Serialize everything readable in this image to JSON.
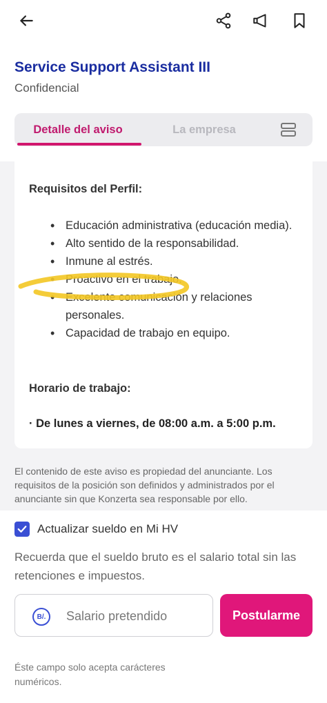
{
  "header": {
    "job_title": "Service Support Assistant III",
    "company": "Confidencial"
  },
  "tabs": [
    {
      "label": "Detalle del aviso",
      "active": true
    },
    {
      "label": "La empresa",
      "active": false
    }
  ],
  "icons": [
    "back-arrow-icon",
    "share-icon",
    "megaphone-icon",
    "bookmark-icon",
    "menu-icon"
  ],
  "description": {
    "requirements_heading": "Requisitos del Perfil:",
    "requirements": [
      "Educación administrativa (educación media).",
      "Alto sentido de la responsabilidad.",
      "Inmune al estrés.",
      "Proactivo en el trabajo.",
      "Excelente comunicación y relaciones personales.",
      "Capacidad de trabajo en equipo."
    ],
    "schedule_heading": "Horario de trabajo:",
    "schedule": "· De lunes a viernes, de 08:00 a.m. a 5:00 p.m."
  },
  "disclaimer": "El contenido de este aviso es propiedad del anunciante. Los requisitos de la posición son definidos y administrados por el anunciante sin que Konzerta sea responsable por ello.",
  "apply_panel": {
    "checkbox_label": "Actualizar sueldo en Mi HV",
    "checkbox_checked": true,
    "note": "Recuerda que el sueldo bruto es el salario total sin las retenciones e impuestos.",
    "currency_symbol": "B/.",
    "salary_placeholder": "Salario pretendido",
    "apply_label": "Postularme",
    "helper": "Éste campo solo acepta carácteres numéricos."
  },
  "colors": {
    "brand_blue": "#1a2da0",
    "accent_pink": "#e0177a",
    "checkbox_blue": "#3a4fd4",
    "highlight_yellow": "#f3c623"
  }
}
